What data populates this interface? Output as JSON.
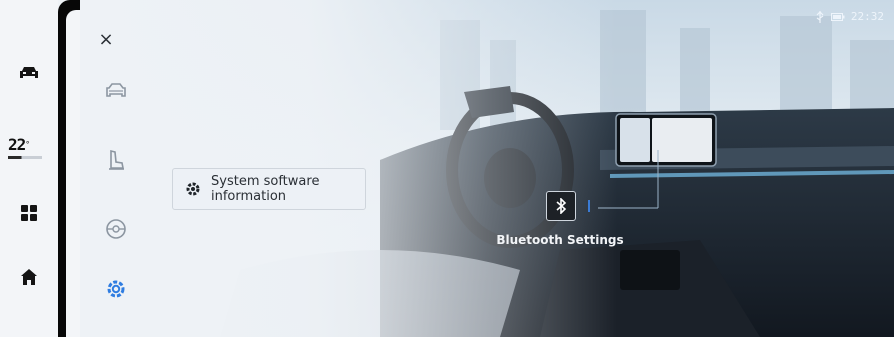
{
  "status": {
    "time": "22:32",
    "icons": [
      "usb-icon",
      "battery-icon"
    ]
  },
  "rail": {
    "items": [
      {
        "name": "car-icon"
      },
      {
        "name": "temperature"
      },
      {
        "name": "apps-grid-icon"
      },
      {
        "name": "home-icon"
      }
    ],
    "temperature": {
      "value": "22",
      "unit": "°"
    }
  },
  "menu": {
    "close": "×",
    "items": [
      {
        "name": "vehicle-icon"
      },
      {
        "name": "seat-icon"
      },
      {
        "name": "steering-wheel-icon"
      },
      {
        "name": "settings-gear-icon",
        "active": true
      }
    ]
  },
  "popup": {
    "label": "System software information"
  },
  "hotspot": {
    "label": "Bluetooth Settings"
  },
  "colors": {
    "accent": "#2f7de1",
    "rail_bg": "#f3f5f8",
    "divider": "#070707"
  }
}
